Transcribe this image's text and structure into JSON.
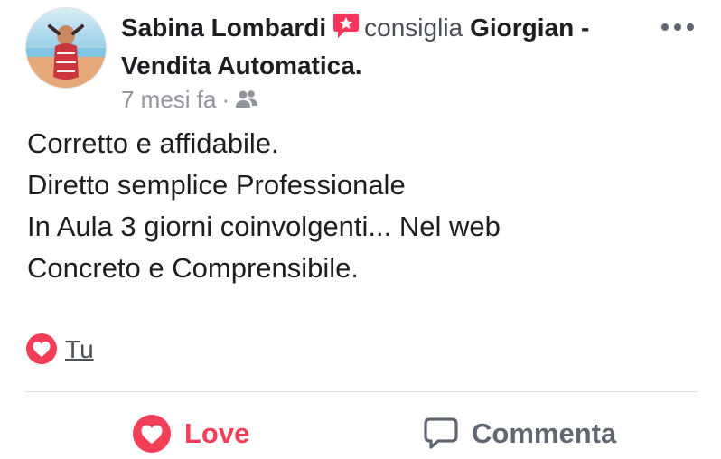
{
  "post": {
    "author": "Sabina Lombardi",
    "verb": "consiglia",
    "page_name": "Giorgian - Vendita Automatica.",
    "time": "7 mesi fa",
    "separator": "·",
    "audience_icon": "friends-icon",
    "recommend_icon": "recommendation-flag-icon",
    "body_lines": [
      "Corretto e affidabile.",
      "Diretto semplice Professionale",
      "In Aula 3 giorni coinvolgenti... Nel web",
      "Concreto e Comprensibile."
    ]
  },
  "reactions": {
    "icon": "heart-icon",
    "label": "Tu"
  },
  "actions": {
    "love_label": "Love",
    "comment_label": "Commenta"
  },
  "colors": {
    "love": "#f33e58",
    "recommend": "#f5365c",
    "text": "#1c1e21",
    "meta": "#90949c",
    "action_gray": "#606770"
  }
}
